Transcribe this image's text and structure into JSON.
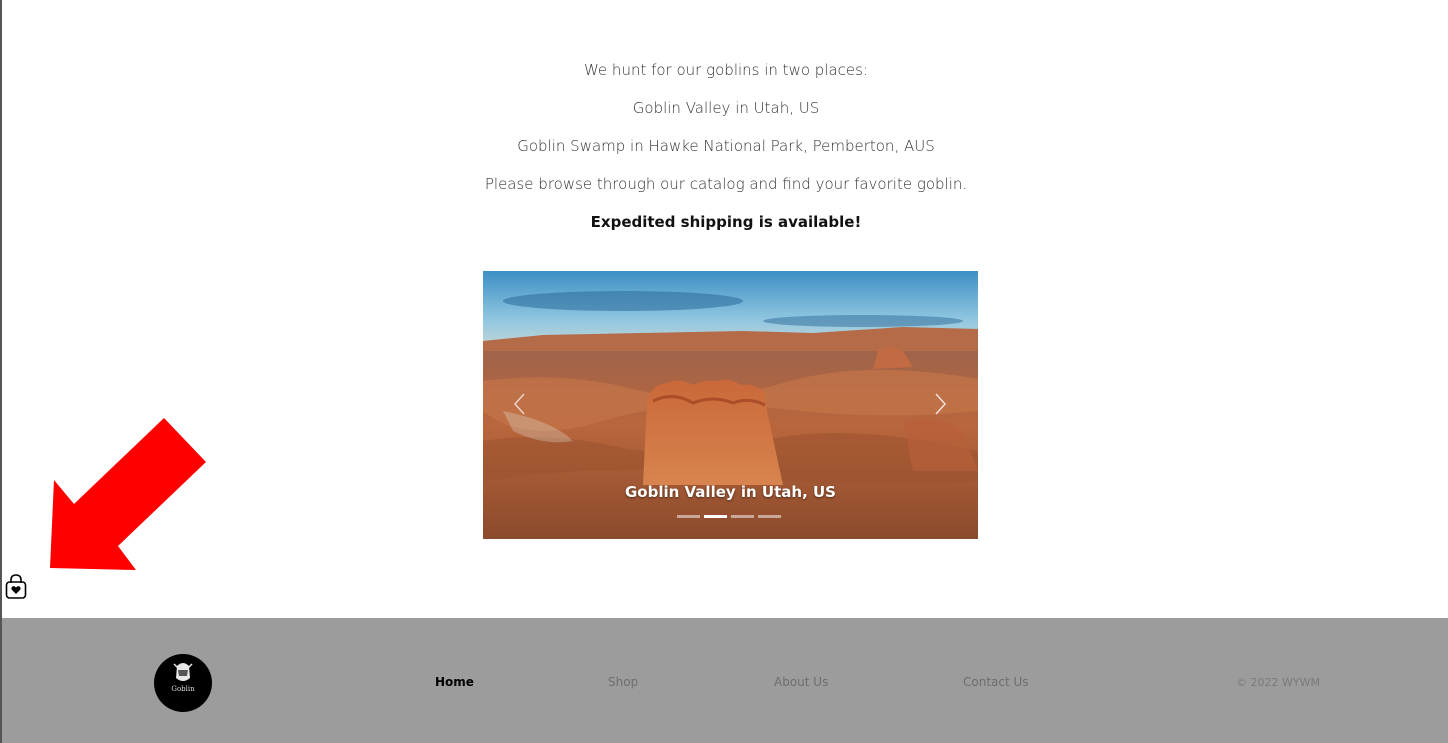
{
  "intro": {
    "line1": "We hunt for our goblins in two places:",
    "line2": "Goblin Valley in Utah, US",
    "line3": "Goblin Swamp in Hawke National Park, Pemberton, AUS",
    "line4": "Please browse through our catalog and find your favorite goblin.",
    "line5": "Expedited shipping is available!"
  },
  "carousel": {
    "caption": "Goblin Valley in Utah, US",
    "prev_icon": "chevron-left-icon",
    "next_icon": "chevron-right-icon",
    "slide_count": 4,
    "active_index": 1
  },
  "overlay": {
    "arrow_icon": "red-arrow-icon",
    "arrow_color": "#ff0000",
    "bag_icon": "shopping-bag-heart-icon"
  },
  "footer": {
    "logo_text": "Goblin",
    "nav": {
      "home": "Home",
      "shop": "Shop",
      "about": "About Us",
      "contact": "Contact Us"
    },
    "copyright": "© 2022 WYWM",
    "background": "#9c9c9c"
  }
}
